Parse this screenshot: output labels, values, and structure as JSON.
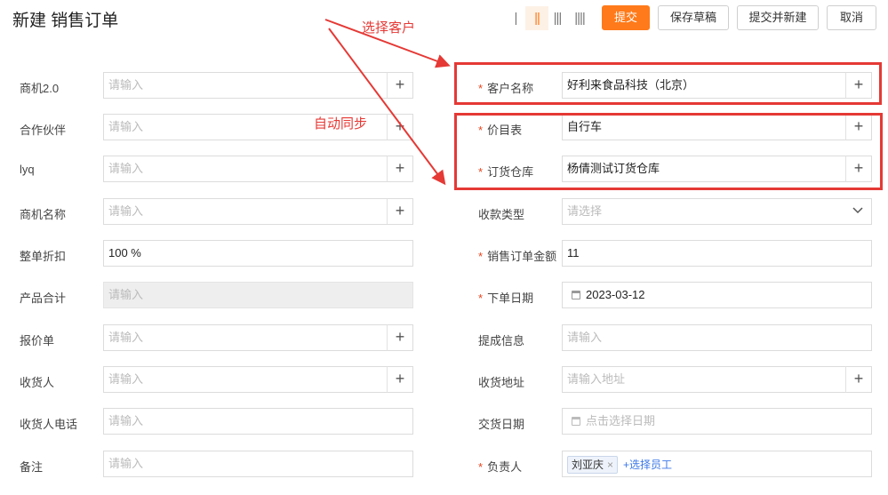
{
  "page": {
    "title": "新建 销售订单"
  },
  "toolbar": {
    "layout_1col": "|",
    "layout_2col": "||",
    "layout_3col": "|||",
    "layout_4col": "||||",
    "submit_label": "提交",
    "save_draft_label": "保存草稿",
    "submit_new_label": "提交并新建",
    "cancel_label": "取消"
  },
  "annotations": {
    "select_customer": "选择客户",
    "auto_sync": "自动同步"
  },
  "left_fields": [
    {
      "label": "商机2.0",
      "placeholder": "请输入",
      "value": "",
      "addon": "+"
    },
    {
      "label": "合作伙伴",
      "placeholder": "请输入",
      "value": "",
      "addon": "+"
    },
    {
      "label": "lyq",
      "placeholder": "请输入",
      "value": "",
      "addon": "+"
    },
    {
      "label": "商机名称",
      "placeholder": "请输入",
      "value": "",
      "addon": "+"
    },
    {
      "label": "整单折扣",
      "placeholder": "",
      "value": "100 %",
      "addon": ""
    },
    {
      "label": "产品合计",
      "placeholder": "请输入",
      "value": "",
      "addon": ""
    },
    {
      "label": "报价单",
      "placeholder": "请输入",
      "value": "",
      "addon": "+"
    },
    {
      "label": "收货人",
      "placeholder": "请输入",
      "value": "",
      "addon": "+"
    },
    {
      "label": "收货人电话",
      "placeholder": "请输入",
      "value": "",
      "addon": ""
    },
    {
      "label": "备注",
      "placeholder": "请输入",
      "value": "",
      "addon": ""
    }
  ],
  "right_fields": [
    {
      "label": "客户名称",
      "required": "*",
      "placeholder": "",
      "value": "好利来食品科技（北京）",
      "addon": "+"
    },
    {
      "label": "价目表",
      "required": "*",
      "placeholder": "",
      "value": "自行车",
      "addon": "+"
    },
    {
      "label": "订货仓库",
      "required": "*",
      "placeholder": "",
      "value": "杨倩测试订货仓库",
      "addon": "+"
    },
    {
      "label": "收款类型",
      "required": "",
      "placeholder": "请选择",
      "value": "",
      "addon": ""
    },
    {
      "label": "销售订单金额",
      "required": "*",
      "placeholder": "",
      "value": "11",
      "addon": ""
    },
    {
      "label": "下单日期",
      "required": "*",
      "placeholder": "",
      "value": "2023-03-12",
      "addon": ""
    },
    {
      "label": "提成信息",
      "required": "",
      "placeholder": "请输入",
      "value": "",
      "addon": ""
    },
    {
      "label": "收货地址",
      "required": "",
      "placeholder": "请输入地址",
      "value": "",
      "addon": "+"
    },
    {
      "label": "交货日期",
      "required": "",
      "placeholder": "点击选择日期",
      "value": "",
      "addon": ""
    },
    {
      "label": "负责人",
      "required": "*",
      "tag": "刘亚庆",
      "tag_close": "×",
      "link": "+选择员工"
    }
  ],
  "icons": {
    "plus": "plus-icon",
    "chevron": "chevron-down-icon",
    "calendar": "calendar-icon",
    "arrow": "red-arrow"
  },
  "colors": {
    "accent": "#ff7a1a",
    "annotation": "#e53935",
    "required": "#e8451e",
    "link": "#3b78e7"
  }
}
